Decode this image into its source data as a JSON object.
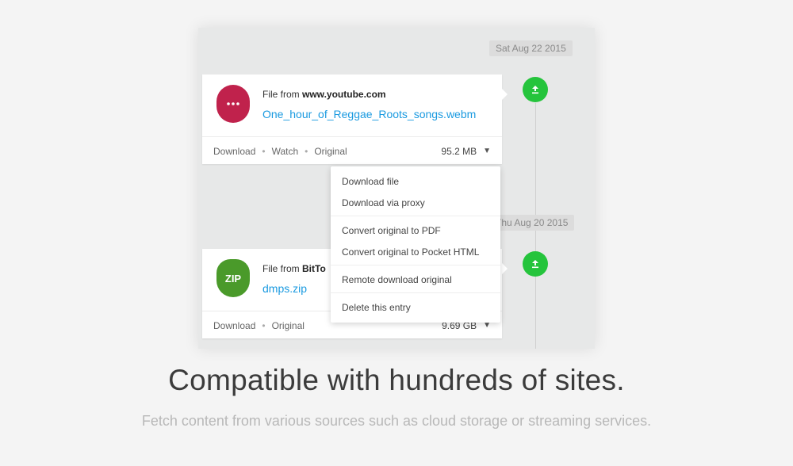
{
  "timeline": {
    "entries": [
      {
        "date": "Sat Aug 22 2015",
        "file_from_prefix": "File from ",
        "source": "www.youtube.com",
        "file_name": "One_hour_of_Reggae_Roots_songs.webm",
        "icon": "video-file-icon",
        "actions": [
          "Download",
          "Watch",
          "Original"
        ],
        "size": "95.2 MB"
      },
      {
        "date": "Thu Aug 20 2015",
        "file_from_prefix": "File from ",
        "source": "BitTo",
        "file_name": "dmps.zip",
        "icon": "zip-file-icon",
        "icon_label": "ZIP",
        "actions": [
          "Download",
          "Original"
        ],
        "size": "9.69 GB"
      }
    ]
  },
  "dropdown": {
    "items": [
      "Download file",
      "Download via proxy",
      "Convert original to PDF",
      "Convert original to Pocket HTML",
      "Remote download original",
      "Delete this entry"
    ]
  },
  "hero": {
    "headline": "Compatible with hundreds of sites.",
    "subline": "Fetch content from various sources such as cloud storage or streaming services."
  },
  "colors": {
    "accent_green": "#25c43c",
    "link_blue": "#1a9ae0",
    "video_icon": "#c0224c",
    "zip_icon": "#4a9a2a"
  }
}
